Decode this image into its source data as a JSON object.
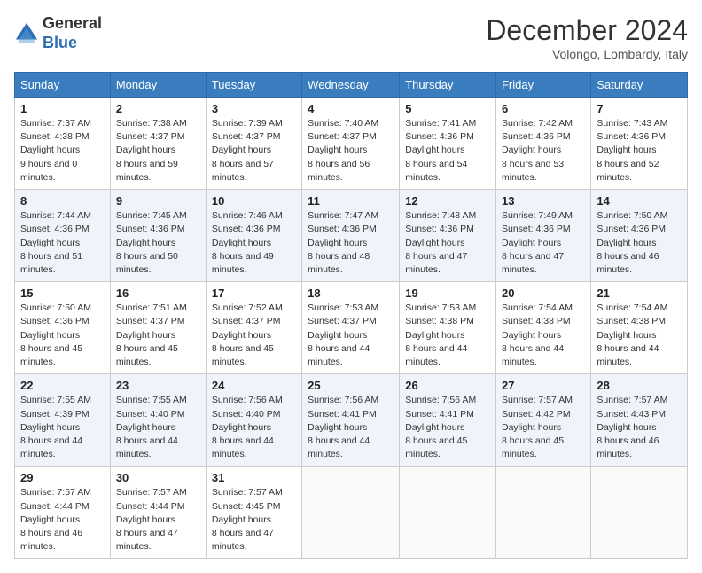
{
  "header": {
    "logo_line1": "General",
    "logo_line2": "Blue",
    "month": "December 2024",
    "location": "Volongo, Lombardy, Italy"
  },
  "columns": [
    "Sunday",
    "Monday",
    "Tuesday",
    "Wednesday",
    "Thursday",
    "Friday",
    "Saturday"
  ],
  "weeks": [
    [
      {
        "day": "1",
        "sunrise": "7:37 AM",
        "sunset": "4:38 PM",
        "daylight": "9 hours and 0 minutes."
      },
      {
        "day": "2",
        "sunrise": "7:38 AM",
        "sunset": "4:37 PM",
        "daylight": "8 hours and 59 minutes."
      },
      {
        "day": "3",
        "sunrise": "7:39 AM",
        "sunset": "4:37 PM",
        "daylight": "8 hours and 57 minutes."
      },
      {
        "day": "4",
        "sunrise": "7:40 AM",
        "sunset": "4:37 PM",
        "daylight": "8 hours and 56 minutes."
      },
      {
        "day": "5",
        "sunrise": "7:41 AM",
        "sunset": "4:36 PM",
        "daylight": "8 hours and 54 minutes."
      },
      {
        "day": "6",
        "sunrise": "7:42 AM",
        "sunset": "4:36 PM",
        "daylight": "8 hours and 53 minutes."
      },
      {
        "day": "7",
        "sunrise": "7:43 AM",
        "sunset": "4:36 PM",
        "daylight": "8 hours and 52 minutes."
      }
    ],
    [
      {
        "day": "8",
        "sunrise": "7:44 AM",
        "sunset": "4:36 PM",
        "daylight": "8 hours and 51 minutes."
      },
      {
        "day": "9",
        "sunrise": "7:45 AM",
        "sunset": "4:36 PM",
        "daylight": "8 hours and 50 minutes."
      },
      {
        "day": "10",
        "sunrise": "7:46 AM",
        "sunset": "4:36 PM",
        "daylight": "8 hours and 49 minutes."
      },
      {
        "day": "11",
        "sunrise": "7:47 AM",
        "sunset": "4:36 PM",
        "daylight": "8 hours and 48 minutes."
      },
      {
        "day": "12",
        "sunrise": "7:48 AM",
        "sunset": "4:36 PM",
        "daylight": "8 hours and 47 minutes."
      },
      {
        "day": "13",
        "sunrise": "7:49 AM",
        "sunset": "4:36 PM",
        "daylight": "8 hours and 47 minutes."
      },
      {
        "day": "14",
        "sunrise": "7:50 AM",
        "sunset": "4:36 PM",
        "daylight": "8 hours and 46 minutes."
      }
    ],
    [
      {
        "day": "15",
        "sunrise": "7:50 AM",
        "sunset": "4:36 PM",
        "daylight": "8 hours and 45 minutes."
      },
      {
        "day": "16",
        "sunrise": "7:51 AM",
        "sunset": "4:37 PM",
        "daylight": "8 hours and 45 minutes."
      },
      {
        "day": "17",
        "sunrise": "7:52 AM",
        "sunset": "4:37 PM",
        "daylight": "8 hours and 45 minutes."
      },
      {
        "day": "18",
        "sunrise": "7:53 AM",
        "sunset": "4:37 PM",
        "daylight": "8 hours and 44 minutes."
      },
      {
        "day": "19",
        "sunrise": "7:53 AM",
        "sunset": "4:38 PM",
        "daylight": "8 hours and 44 minutes."
      },
      {
        "day": "20",
        "sunrise": "7:54 AM",
        "sunset": "4:38 PM",
        "daylight": "8 hours and 44 minutes."
      },
      {
        "day": "21",
        "sunrise": "7:54 AM",
        "sunset": "4:38 PM",
        "daylight": "8 hours and 44 minutes."
      }
    ],
    [
      {
        "day": "22",
        "sunrise": "7:55 AM",
        "sunset": "4:39 PM",
        "daylight": "8 hours and 44 minutes."
      },
      {
        "day": "23",
        "sunrise": "7:55 AM",
        "sunset": "4:40 PM",
        "daylight": "8 hours and 44 minutes."
      },
      {
        "day": "24",
        "sunrise": "7:56 AM",
        "sunset": "4:40 PM",
        "daylight": "8 hours and 44 minutes."
      },
      {
        "day": "25",
        "sunrise": "7:56 AM",
        "sunset": "4:41 PM",
        "daylight": "8 hours and 44 minutes."
      },
      {
        "day": "26",
        "sunrise": "7:56 AM",
        "sunset": "4:41 PM",
        "daylight": "8 hours and 45 minutes."
      },
      {
        "day": "27",
        "sunrise": "7:57 AM",
        "sunset": "4:42 PM",
        "daylight": "8 hours and 45 minutes."
      },
      {
        "day": "28",
        "sunrise": "7:57 AM",
        "sunset": "4:43 PM",
        "daylight": "8 hours and 46 minutes."
      }
    ],
    [
      {
        "day": "29",
        "sunrise": "7:57 AM",
        "sunset": "4:44 PM",
        "daylight": "8 hours and 46 minutes."
      },
      {
        "day": "30",
        "sunrise": "7:57 AM",
        "sunset": "4:44 PM",
        "daylight": "8 hours and 47 minutes."
      },
      {
        "day": "31",
        "sunrise": "7:57 AM",
        "sunset": "4:45 PM",
        "daylight": "8 hours and 47 minutes."
      },
      null,
      null,
      null,
      null
    ]
  ]
}
